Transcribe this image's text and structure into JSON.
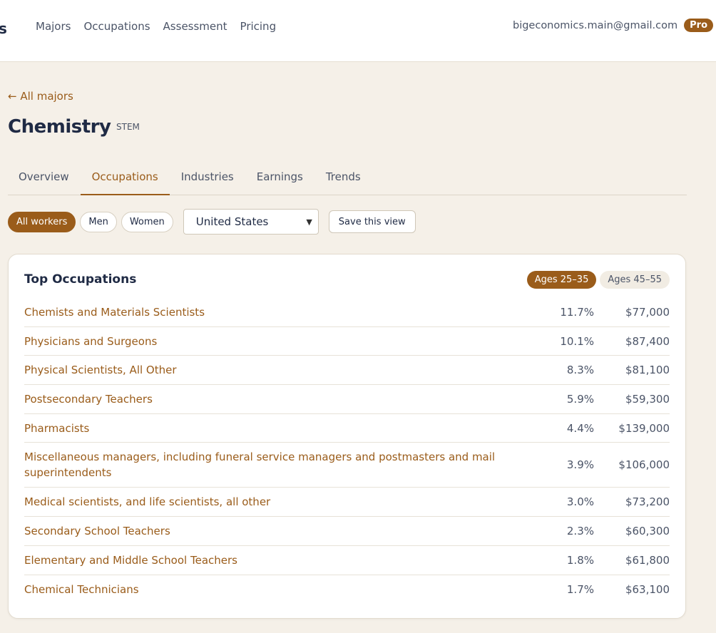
{
  "header": {
    "logo_fragment": "s",
    "nav": [
      "Majors",
      "Occupations",
      "Assessment",
      "Pricing"
    ],
    "email": "bigeconomics.main@gmail.com",
    "badge": "Pro"
  },
  "page": {
    "back_link": "← All majors",
    "title": "Chemistry",
    "tag": "STEM"
  },
  "tabs": [
    "Overview",
    "Occupations",
    "Industries",
    "Earnings",
    "Trends"
  ],
  "active_tab": "Occupations",
  "filters": {
    "pills": [
      "All workers",
      "Men",
      "Women"
    ],
    "region": "United States",
    "save_label": "Save this view"
  },
  "card": {
    "title": "Top Occupations",
    "age_groups": [
      "Ages 25–35",
      "Ages 45–55"
    ],
    "rows": [
      {
        "name": "Chemists and Materials Scientists",
        "share": "11.7%",
        "salary": "$77,000"
      },
      {
        "name": "Physicians and Surgeons",
        "share": "10.1%",
        "salary": "$87,400"
      },
      {
        "name": "Physical Scientists, All Other",
        "share": "8.3%",
        "salary": "$81,100"
      },
      {
        "name": "Postsecondary Teachers",
        "share": "5.9%",
        "salary": "$59,300"
      },
      {
        "name": "Pharmacists",
        "share": "4.4%",
        "salary": "$139,000"
      },
      {
        "name": "Miscellaneous managers, including funeral service managers and postmasters and mail superintendents",
        "share": "3.9%",
        "salary": "$106,000"
      },
      {
        "name": "Medical scientists, and life scientists, all other",
        "share": "3.0%",
        "salary": "$73,200"
      },
      {
        "name": "Secondary School Teachers",
        "share": "2.3%",
        "salary": "$60,300"
      },
      {
        "name": "Elementary and Middle School Teachers",
        "share": "1.8%",
        "salary": "$61,800"
      },
      {
        "name": "Chemical Technicians",
        "share": "1.7%",
        "salary": "$63,100"
      }
    ]
  },
  "colors": {
    "accent": "#9a5c1a",
    "background": "#f5f0e8",
    "text": "#1f2a44"
  }
}
